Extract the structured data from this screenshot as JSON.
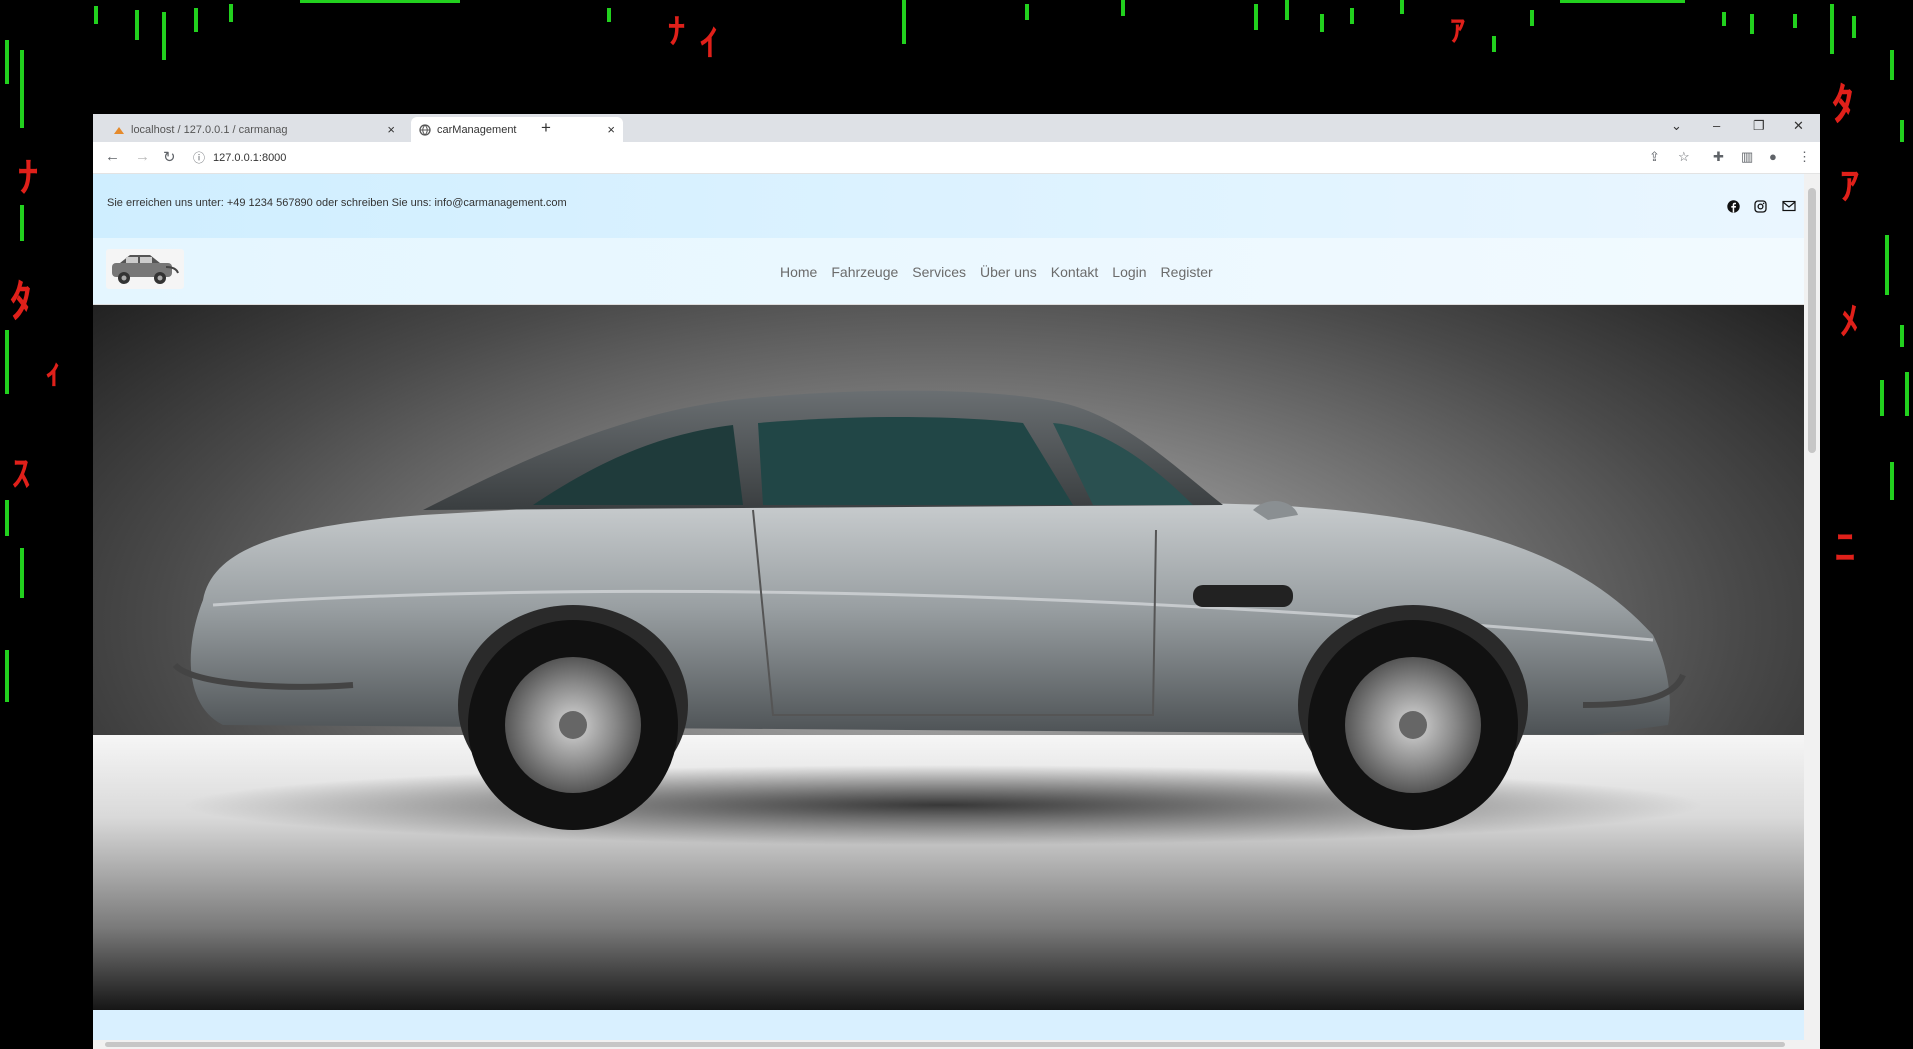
{
  "browser": {
    "tabs": [
      {
        "label": "localhost / 127.0.0.1 / carmanag"
      },
      {
        "label": "carManagement"
      }
    ],
    "address": "127.0.0.1:8000"
  },
  "page": {
    "contact_text": "Sie erreichen uns unter: +49 1234 567890 oder schreiben Sie uns: info@carmanagement.com",
    "nav": [
      "Home",
      "Fahrzeuge",
      "Services",
      "Über uns",
      "Kontakt",
      "Login",
      "Register"
    ]
  },
  "icons": {
    "social": [
      "facebook-icon",
      "instagram-icon",
      "mail-icon"
    ]
  }
}
